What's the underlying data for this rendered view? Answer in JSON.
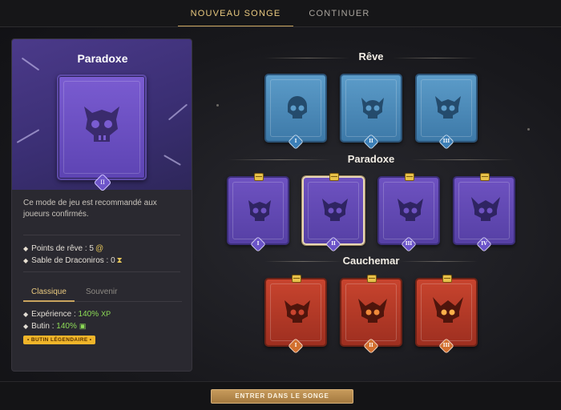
{
  "tabs": {
    "new_dream": "NOUVEAU SONGE",
    "continue": "CONTINUER"
  },
  "panel": {
    "title": "Paradoxe",
    "card_level": "II",
    "description": "Ce mode de jeu est recommandé aux joueurs confirmés.",
    "stats": [
      {
        "label": "Points de rêve : 5",
        "icon": "swirl-icon"
      },
      {
        "label": "Sable de Draconiros : 0",
        "icon": "hourglass-icon"
      }
    ],
    "subtabs": {
      "classic": "Classique",
      "souvenir": "Souvenir"
    },
    "bonuses": [
      {
        "label": "Expérience : ",
        "value": "140%",
        "unit": "XP"
      },
      {
        "label": "Butin : ",
        "value": "140%",
        "unit": "chest-icon"
      }
    ],
    "legend_tag": "• BUTIN LÉGENDAIRE •"
  },
  "sections": {
    "reve": {
      "title": "Rêve",
      "levels": [
        "I",
        "II",
        "III"
      ]
    },
    "paradoxe": {
      "title": "Paradoxe",
      "levels": [
        "I",
        "II",
        "III",
        "IV"
      ],
      "selected": "II"
    },
    "cauchemar": {
      "title": "Cauchemar",
      "levels": [
        "I",
        "II",
        "III"
      ]
    }
  },
  "enter_button": "ENTRER DANS LE SONGE",
  "colors": {
    "accent": "#c9a45f",
    "blue": "#4b8abb",
    "purple": "#6248b8",
    "red": "#b33a27",
    "green": "#8ddc56"
  }
}
